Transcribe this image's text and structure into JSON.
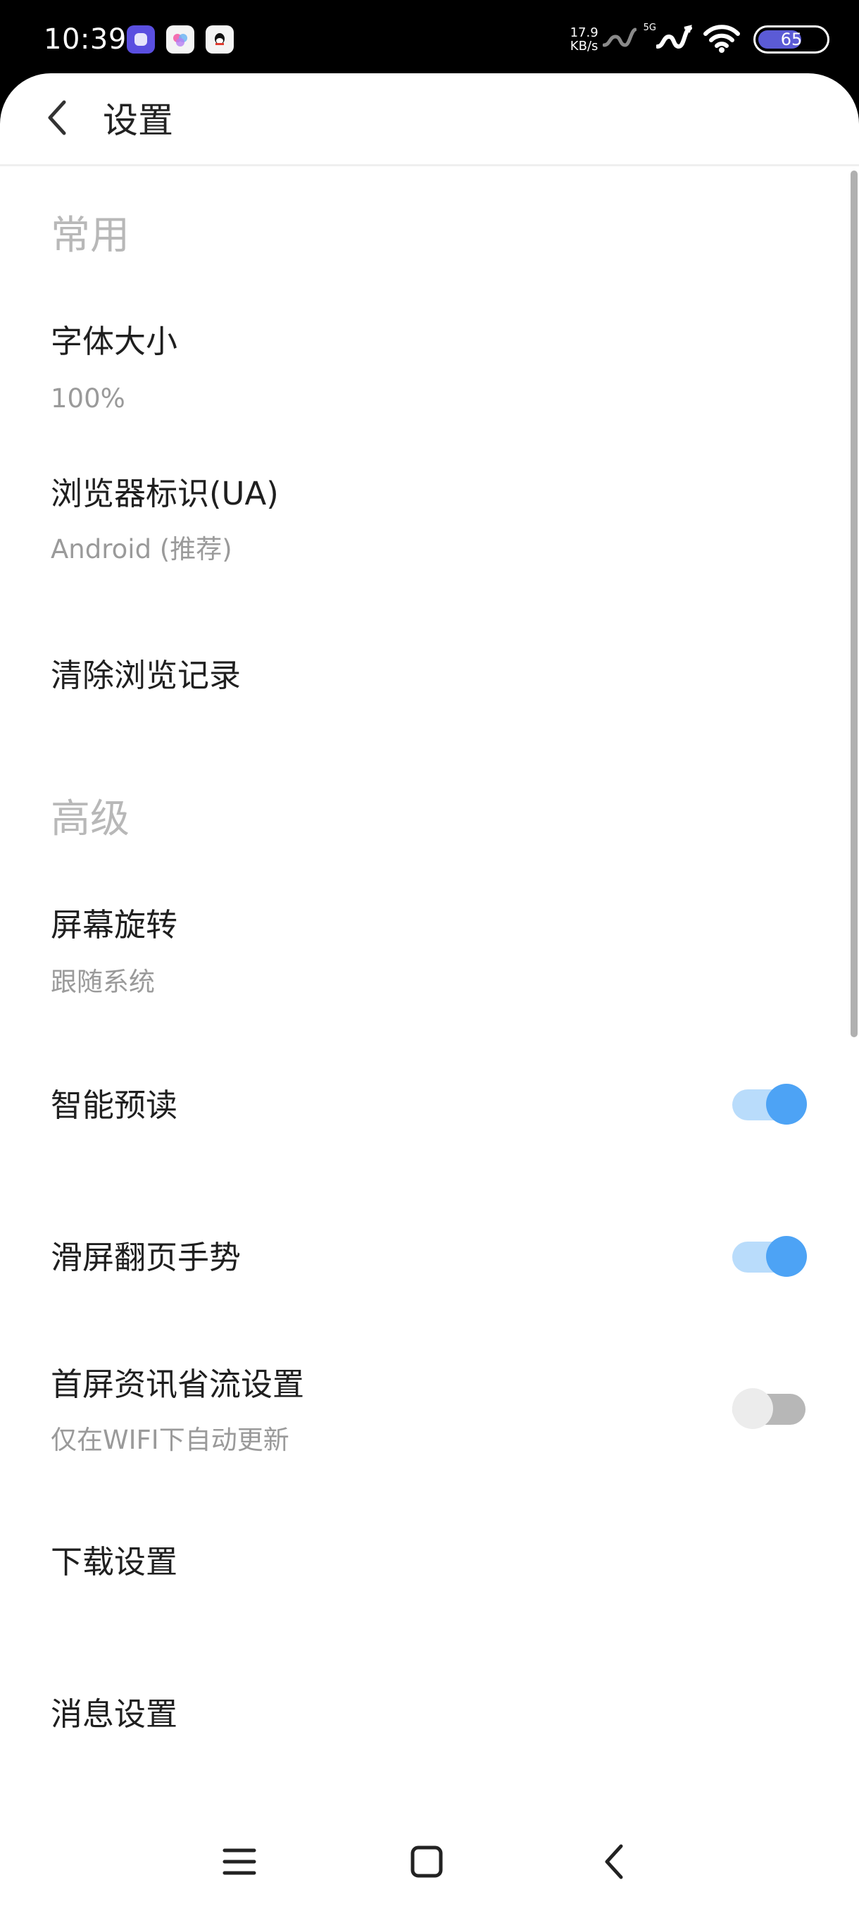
{
  "status_bar": {
    "time": "10:39",
    "net_speed_value": "17.9",
    "net_speed_unit": "KB/s",
    "signal_label": "5G",
    "battery_level": "65",
    "battery_fraction": 0.65,
    "notification_icons": [
      "purple-app-icon",
      "colorful-app-icon",
      "qq-app-icon"
    ]
  },
  "header": {
    "title": "设置"
  },
  "sections": {
    "common": {
      "header": "常用",
      "font_size": {
        "title": "字体大小",
        "value": "100%"
      },
      "ua": {
        "title": "浏览器标识(UA)",
        "value": "Android (推荐)"
      },
      "clear_history": {
        "title": "清除浏览记录"
      }
    },
    "advanced": {
      "header": "高级",
      "rotation": {
        "title": "屏幕旋转",
        "value": "跟随系统"
      },
      "smart_preread": {
        "title": "智能预读",
        "enabled": true
      },
      "swipe_gesture": {
        "title": "滑屏翻页手势",
        "enabled": true
      },
      "data_saver": {
        "title": "首屏资讯省流设置",
        "value": "仅在WIFI下自动更新",
        "enabled": false
      },
      "download_settings": {
        "title": "下载设置"
      },
      "message_settings": {
        "title": "消息设置"
      }
    }
  },
  "colors": {
    "toggle_on_knob": "#4da3f5",
    "toggle_on_track": "#b9dcfb",
    "toggle_off_knob": "#ececec",
    "toggle_off_track": "#b7b7b7",
    "section_header": "#b8b8b8"
  },
  "nav_bar": {
    "icons": [
      "menu-icon",
      "home-icon",
      "back-icon"
    ]
  }
}
